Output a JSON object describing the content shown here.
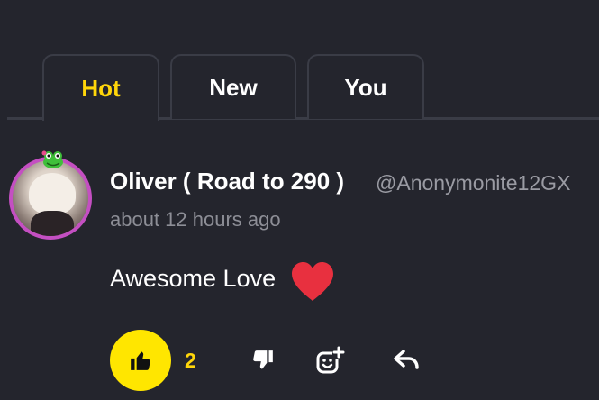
{
  "tabs": [
    {
      "label": "Hot",
      "active": true
    },
    {
      "label": "New",
      "active": false
    },
    {
      "label": "You",
      "active": false
    }
  ],
  "comment": {
    "author": "Oliver ( Road to 290 )",
    "handle": "@Anonymonite12GX",
    "timestamp": "about 12 hours ago",
    "text": "Awesome Love",
    "likes": "2",
    "avatar_icon": "user-avatar",
    "avatar_badge_icon": "frog-badge-icon",
    "emoji": "heart-icon"
  },
  "actions": {
    "like_icon": "thumbs-up-icon",
    "dislike_icon": "thumbs-down-icon",
    "react_icon": "add-emoji-icon",
    "reply_icon": "reply-icon"
  },
  "colors": {
    "background": "#24252d",
    "accent": "#ffd60a",
    "like_button": "#ffe600",
    "avatar_ring": "#c44fc2",
    "heart": "#e8303f",
    "muted_text": "#8d8e96"
  }
}
